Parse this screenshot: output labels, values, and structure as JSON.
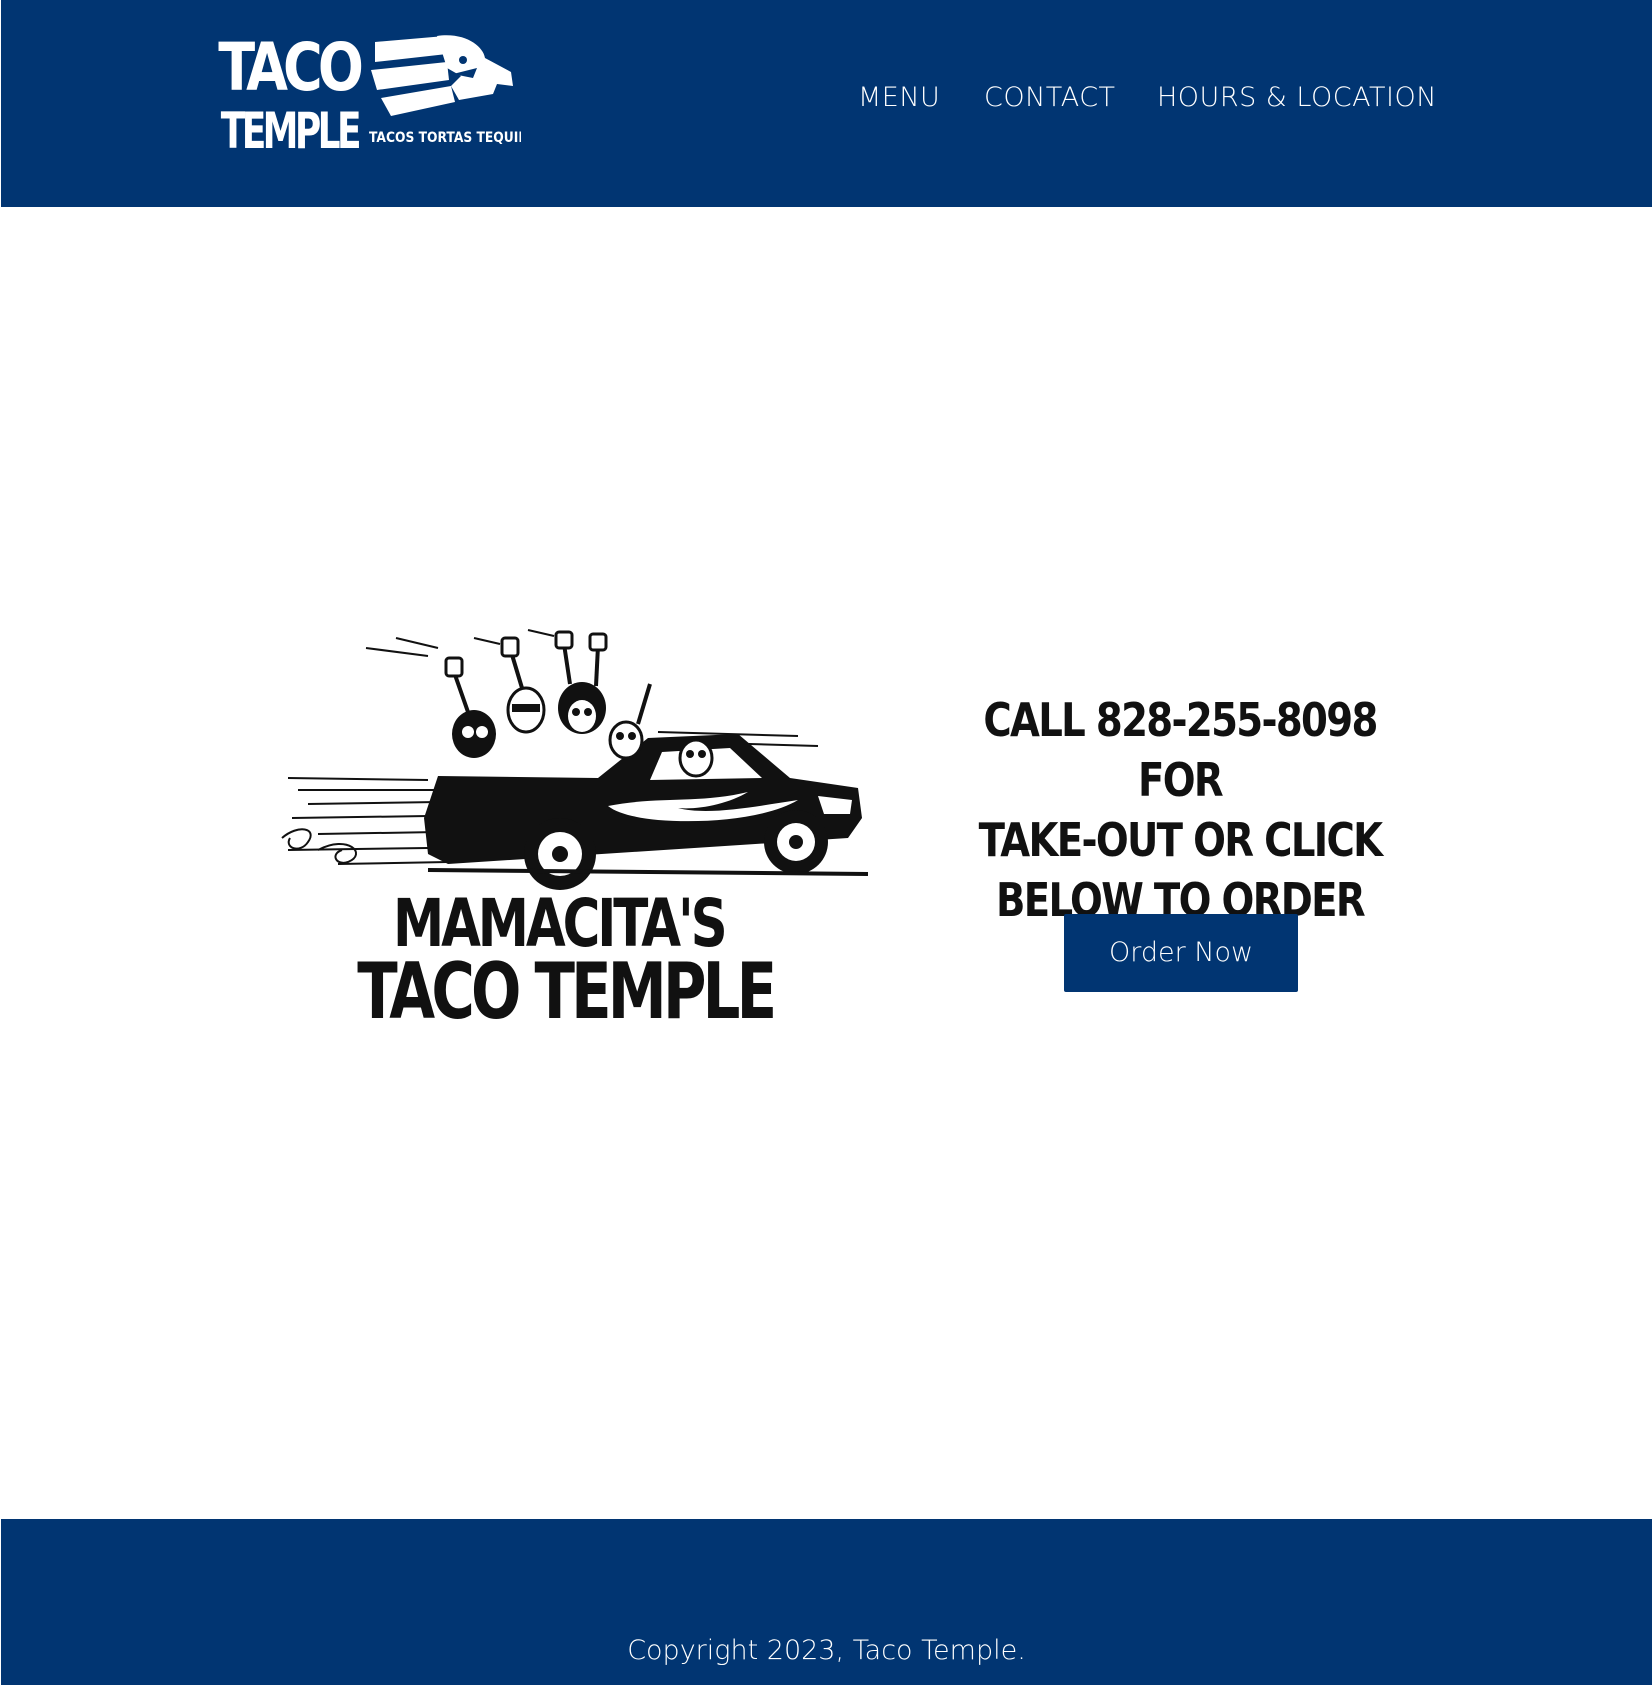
{
  "header": {
    "logo_text_line1": "TACO",
    "logo_text_line2": "TEMPLE",
    "logo_tagline": "TACOS  TORTAS  TEQUILA",
    "nav": [
      {
        "label": "MENU"
      },
      {
        "label": "CONTACT"
      },
      {
        "label": "HOURS & LOCATION"
      }
    ]
  },
  "main": {
    "illustration_title_line1": "MAMACITA'S",
    "illustration_title_line2": "TACO TEMPLE",
    "cta_line1": "CALL 828-255-8098 FOR",
    "cta_line2": "TAKE-OUT OR CLICK",
    "cta_line3": "BELOW TO ORDER ONLINE!",
    "order_button": "Order Now"
  },
  "footer": {
    "copyright": "Copyright 2023, Taco Temple."
  },
  "colors": {
    "brand_blue": "#013572",
    "white": "#ffffff",
    "text_dark": "#111111"
  },
  "icons": {
    "logo": "eagle-head-logo-icon",
    "illustration": "skeletons-in-car-illustration"
  }
}
